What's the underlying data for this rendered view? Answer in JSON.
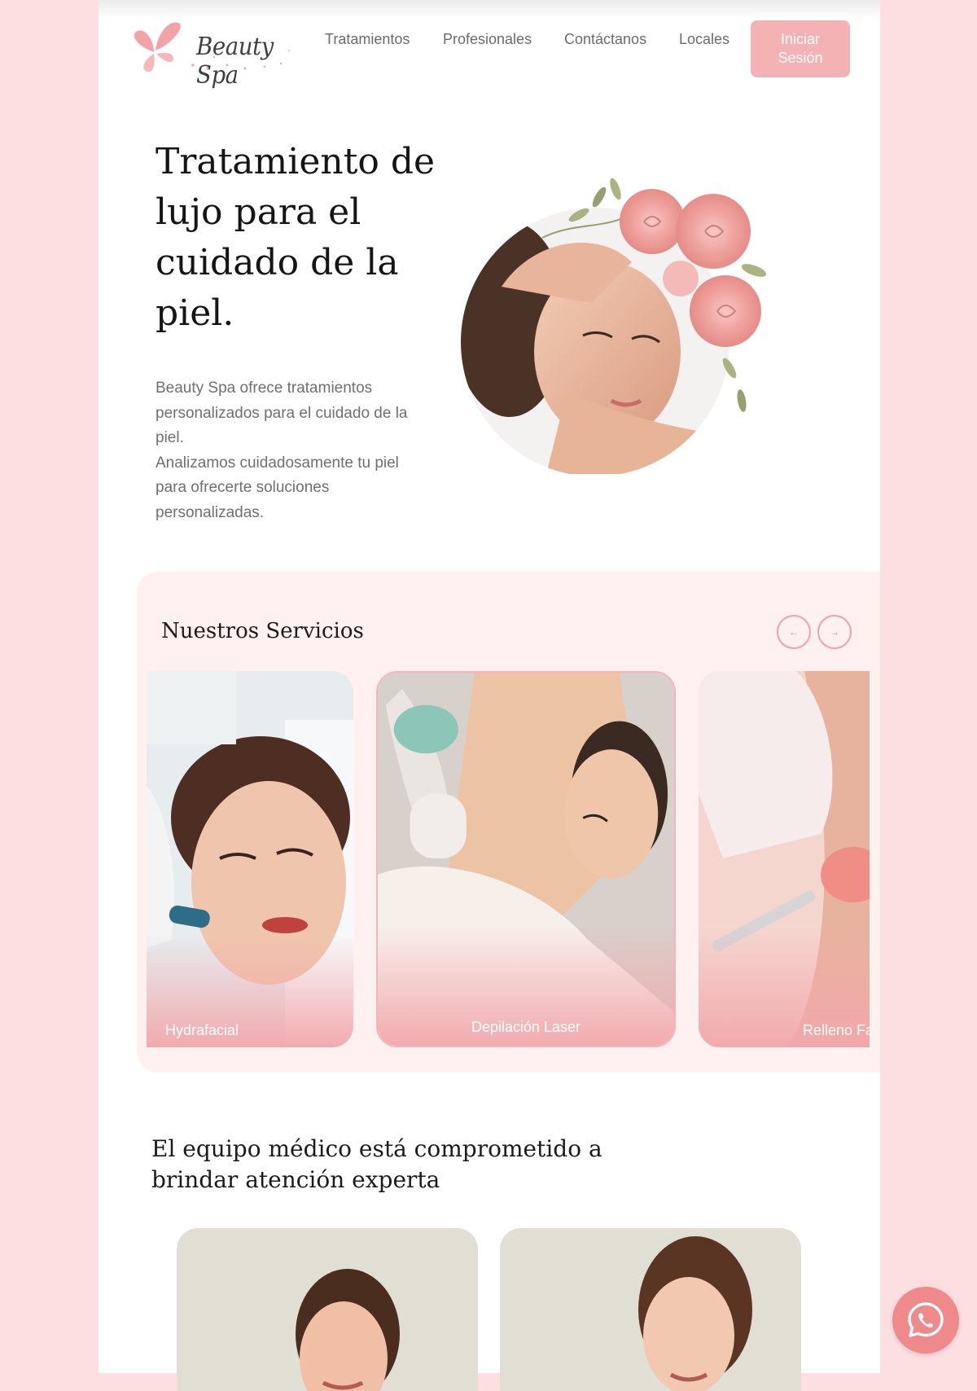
{
  "header": {
    "logo_text": "Beauty Spa",
    "nav": [
      "Tratamientos",
      "Profesionales",
      "Contáctanos",
      "Locales"
    ],
    "login_label": "Iniciar Sesión"
  },
  "hero": {
    "title": "Tratamiento de lujo para el cuidado de la piel.",
    "text_lines": [
      "Beauty Spa ofrece tratamientos personalizados para el cuidado de la piel.",
      "Analizamos cuidadosamente tu piel para ofrecerte soluciones personalizadas."
    ]
  },
  "services": {
    "title": "Nuestros Servicios",
    "prev_label": "←",
    "next_label": "→",
    "cards": [
      {
        "label": "Hydrafacial"
      },
      {
        "label": "Depilación Laser"
      },
      {
        "label": "Relleno Fa"
      }
    ]
  },
  "team": {
    "title": "El equipo médico está comprometido a brindar atención experta"
  },
  "colors": {
    "background": "#fddfe2",
    "accent": "#f4b2b4",
    "services_bg": "#fff1ef",
    "whatsapp": "#ee8a8b"
  },
  "icons": [
    "butterfly-logo-icon",
    "arrow-left-icon",
    "arrow-right-icon",
    "whatsapp-icon"
  ]
}
